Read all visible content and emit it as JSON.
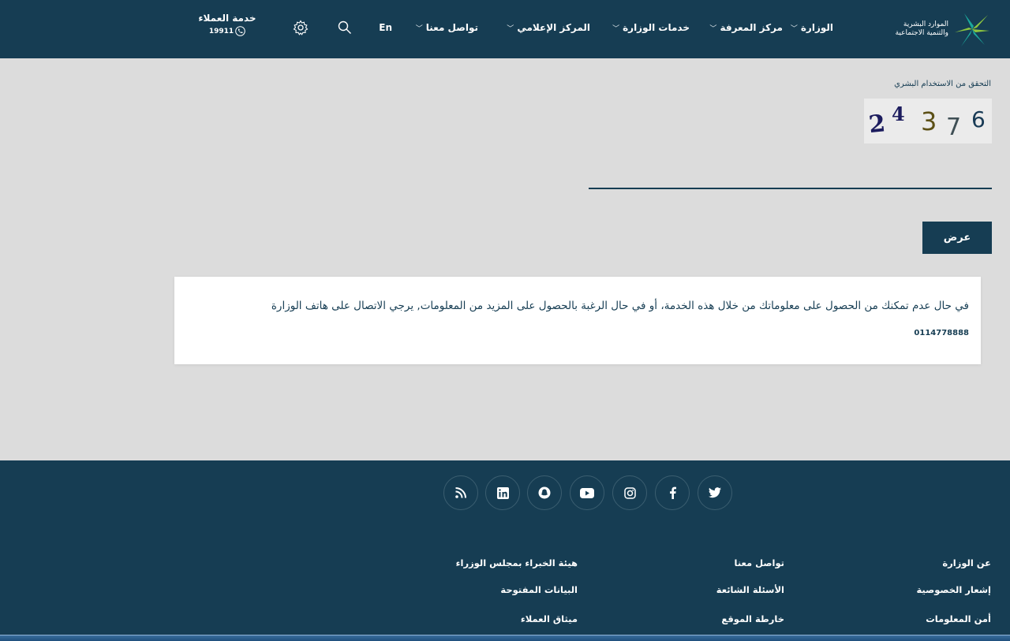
{
  "header": {
    "logo_line1": "الموارد البشرية",
    "logo_line2": "والتنمية الاجتماعية",
    "nav": [
      {
        "label": "الوزارة",
        "has_dropdown": true
      },
      {
        "label": "مركز المعرفة",
        "has_dropdown": true
      },
      {
        "label": "خدمات الوزارة",
        "has_dropdown": true
      },
      {
        "label": "المركز الإعلامي",
        "has_dropdown": true
      },
      {
        "label": "تواصل معنا",
        "has_dropdown": true
      }
    ],
    "language_label": "En",
    "search_icon": "search-icon",
    "settings_icon": "gear-icon",
    "customer_service_title": "خدمة العملاء",
    "customer_service_number": "19911",
    "brand_colors": {
      "navy": "#163d53",
      "green": "#8dc63f",
      "teal": "#1ba89c"
    }
  },
  "main": {
    "captcha_label": "التحقق من الاستخدام البشري",
    "captcha_digits": [
      "2",
      "4",
      "3",
      "7",
      "6"
    ],
    "captcha_input_value": "",
    "submit_label": "عرض",
    "notice_text": "في حال عدم تمكنك من الحصول على معلوماتك من خلال هذه الخدمة، أو في حال الرغبة بالحصول على المزيد من المعلومات, يرجي الاتصال على هاتف الوزارة",
    "notice_phone": "0114778888"
  },
  "footer": {
    "social": [
      "twitter-icon",
      "facebook-icon",
      "instagram-icon",
      "youtube-icon",
      "snapchat-icon",
      "linkedin-icon",
      "rss-icon"
    ],
    "links": {
      "col1": [
        "عن الوزارة",
        "إشعار الخصوصية",
        "أمن المعلومات"
      ],
      "col2": [
        "تواصل معنا",
        "الأسئلة الشائعة",
        "خارطة الموقع"
      ],
      "col3": [
        "هيئة الخبراء بمجلس الوزراء",
        "البيانات المفتوحة",
        "ميثاق العملاء"
      ]
    }
  }
}
